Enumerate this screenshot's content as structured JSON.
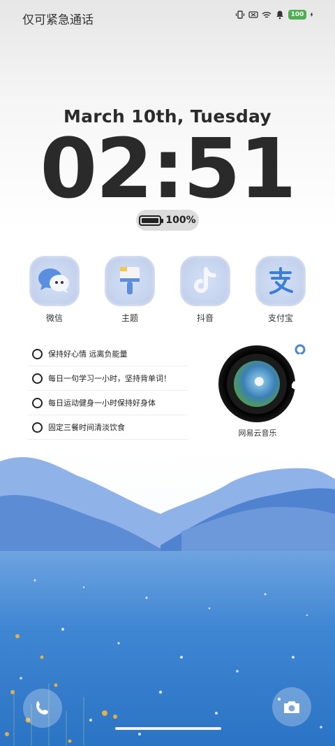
{
  "status_bar": {
    "carrier_text": "仅可紧急通话",
    "battery_level": "100"
  },
  "lock": {
    "date": "March 10th, Tuesday",
    "time": "02:51",
    "battery_percent": "100%",
    "battery_fraction": 1.0
  },
  "apps": [
    {
      "label": "微信",
      "icon": "wechat-icon"
    },
    {
      "label": "主题",
      "icon": "theme-brush-icon"
    },
    {
      "label": "抖音",
      "icon": "tiktok-icon"
    },
    {
      "label": "支付宝",
      "icon": "alipay-icon"
    }
  ],
  "todo": {
    "items": [
      "保持好心情 远离负能量",
      "每日一句学习一小时，坚持背单词！",
      "每日运动健身一小时保持好身体",
      "固定三餐时间清淡饮食"
    ]
  },
  "music": {
    "label": "网易云音乐"
  },
  "shortcuts": {
    "left": "phone-icon",
    "right": "camera-icon"
  },
  "colors": {
    "icon_bg": "#c6d4ee",
    "accent_blue": "#4a86d6",
    "battery_green": "#4caf50"
  }
}
